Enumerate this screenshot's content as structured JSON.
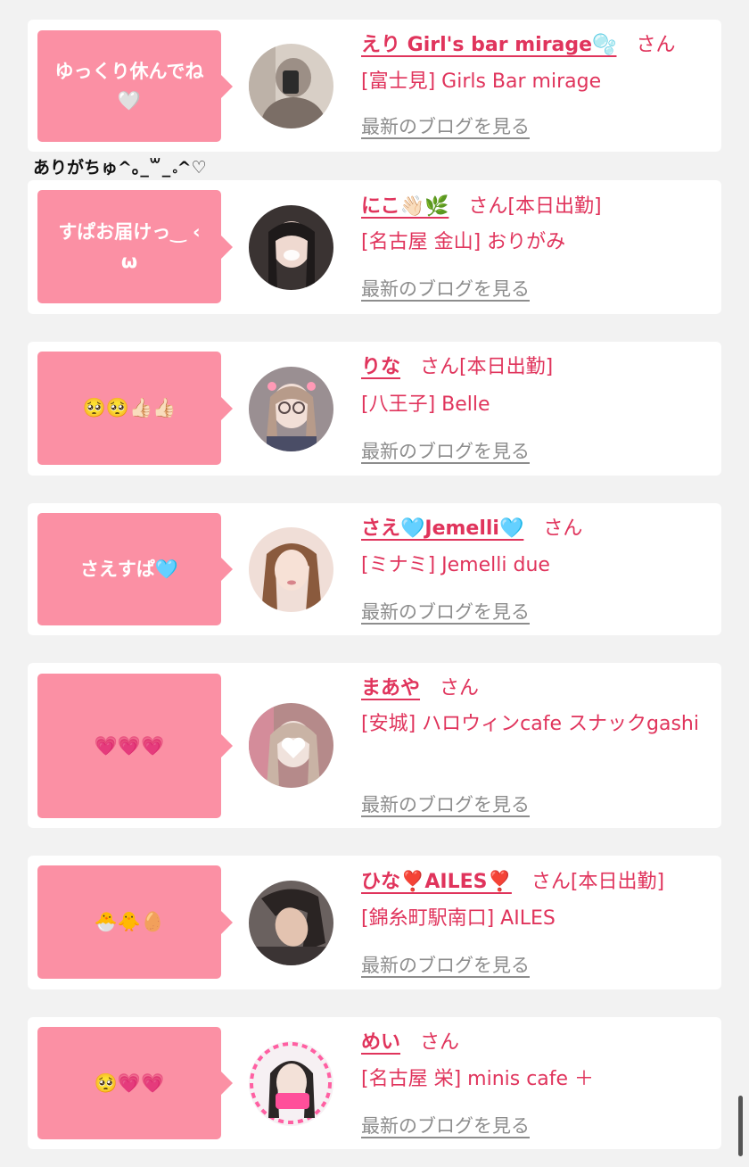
{
  "posts": [
    {
      "bubble": "ゆっくり休んでね🤍",
      "name": "えり Girl's bar mirage🫧",
      "san": "さん",
      "status": "",
      "store": "[富士見] Girls Bar mirage",
      "blog_link": "最新のブログを見る"
    },
    {
      "bubble": "すぱお届けっ‿ ‹ ω",
      "name": "にこ👋🏻🌿",
      "san": "さん",
      "status": "[本日出勤]",
      "store": "[名古屋 金山] おりがみ",
      "blog_link": "最新のブログを見る"
    },
    {
      "bubble": "🥺🥺👍🏻👍🏻",
      "name": "りな",
      "san": "さん",
      "status": "[本日出勤]",
      "store": "[八王子] Belle",
      "blog_link": "最新のブログを見る"
    },
    {
      "bubble": "さえすぱ🩵",
      "name": "さえ🩵Jemelli🩵",
      "san": "さん",
      "status": "",
      "store": "[ミナミ] Jemelli due",
      "blog_link": "最新のブログを見る"
    },
    {
      "bubble": "💗💗💗",
      "name": "まあや",
      "san": "さん",
      "status": "",
      "store": "[安城] ハロウィンcafe スナックgashi",
      "blog_link": "最新のブログを見る"
    },
    {
      "bubble": "🐣🐥🥚",
      "name": "ひな❣️AILES❣️",
      "san": "さん",
      "status": "[本日出勤]",
      "store": "[錦糸町駅南口] AILES",
      "blog_link": "最新のブログを見る"
    },
    {
      "bubble": "🥺💗💗",
      "name": "めい",
      "san": "さん",
      "status": "",
      "store": "[名古屋 栄] minis cafe ＋",
      "blog_link": "最新のブログを見る"
    }
  ],
  "comment": "ありがちゅ^｡_꒳_｡^♡",
  "colors": {
    "bubble": "#fb90a4",
    "accent": "#e0345c",
    "link_gray": "#8d8d8d",
    "page_bg": "#f2f2f2"
  }
}
